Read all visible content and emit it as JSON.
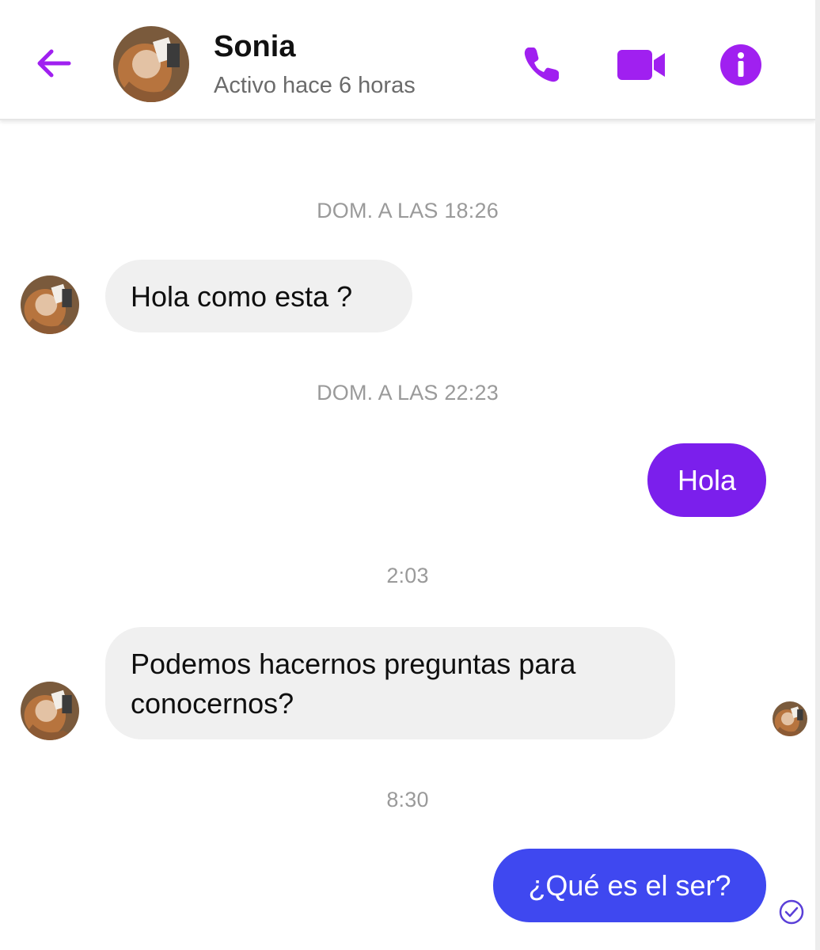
{
  "header": {
    "contact_name": "Sonia",
    "contact_status": "Activo hace 6 horas",
    "icons": {
      "back": "arrow-left-icon",
      "call": "phone-icon",
      "video": "video-camera-icon",
      "info": "info-icon"
    }
  },
  "colors": {
    "accent_purple": "#a020f0",
    "outgoing_bubble_1": "#7b1fec",
    "outgoing_bubble_2": "#3f48f0",
    "incoming_bubble": "#f0f0f0",
    "timestamp_text": "#9a9a9a"
  },
  "chat": {
    "timestamps": [
      "DOM. A LAS 18:26",
      "DOM. A LAS 22:23",
      "2:03",
      "8:30"
    ],
    "messages": [
      {
        "direction": "incoming",
        "text": "Hola como esta ?"
      },
      {
        "direction": "outgoing",
        "text": "Hola"
      },
      {
        "direction": "incoming",
        "text": "Podemos hacernos preguntas para conocernos?"
      },
      {
        "direction": "outgoing",
        "text": "¿Qué es el ser?"
      }
    ]
  }
}
